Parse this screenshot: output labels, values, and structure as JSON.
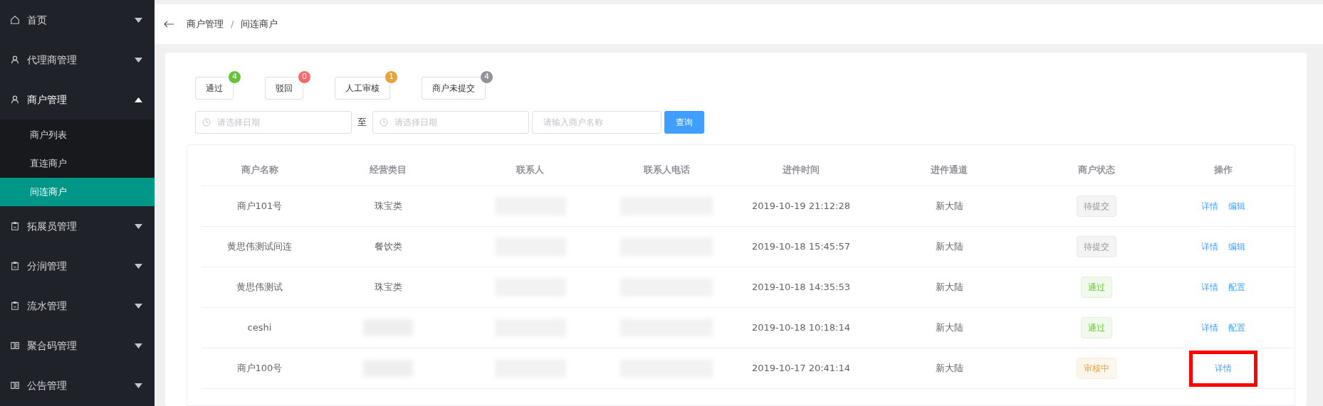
{
  "sidebar": {
    "items": [
      {
        "label": "首页",
        "expanded": false
      },
      {
        "label": "代理商管理",
        "expanded": false
      },
      {
        "label": "商户管理",
        "expanded": true,
        "children": [
          {
            "label": "商户列表",
            "selected": false
          },
          {
            "label": "直连商户",
            "selected": false
          },
          {
            "label": "间连商户",
            "selected": true
          }
        ]
      },
      {
        "label": "拓展员管理",
        "expanded": false
      },
      {
        "label": "分润管理",
        "expanded": false
      },
      {
        "label": "流水管理",
        "expanded": false
      },
      {
        "label": "聚合码管理",
        "expanded": false
      },
      {
        "label": "公告管理",
        "expanded": false
      }
    ]
  },
  "breadcrumb": [
    "商户管理",
    "/",
    "间连商户"
  ],
  "status_filters": [
    {
      "label": "通过",
      "count": "4",
      "color": "#67c23a"
    },
    {
      "label": "驳回",
      "count": "0",
      "color": "#f56c6c"
    },
    {
      "label": "人工审核",
      "count": "1",
      "color": "#e6a23c"
    },
    {
      "label": "商户未提交",
      "count": "4",
      "color": "#909399"
    }
  ],
  "search": {
    "start_date": {
      "placeholder": "请选择日期"
    },
    "separator": "至",
    "end_date": {
      "placeholder": "请选择日期"
    },
    "name": {
      "placeholder": "请输入商户名称"
    },
    "button": "查询"
  },
  "table": {
    "columns": [
      "商户名称",
      "经营类目",
      "联系人",
      "联系人电话",
      "进件时间",
      "进件通道",
      "商户状态",
      "操作"
    ],
    "rows": [
      {
        "name": "商户101号",
        "category": "珠宝类",
        "time": "2019-10-19 21:12:28",
        "channel": "新大陆",
        "status": {
          "label": "待提交",
          "kind": "pending"
        },
        "actions": [
          "详情",
          "编辑"
        ],
        "highlighted": false
      },
      {
        "name": "黄思伟测试间连",
        "category": "餐饮类",
        "time": "2019-10-18 15:45:57",
        "channel": "新大陆",
        "status": {
          "label": "待提交",
          "kind": "pending"
        },
        "actions": [
          "详情",
          "编辑"
        ],
        "highlighted": false
      },
      {
        "name": "黄思伟测试",
        "category": "珠宝类",
        "time": "2019-10-18 14:35:53",
        "channel": "新大陆",
        "status": {
          "label": "通过",
          "kind": "passed"
        },
        "actions": [
          "详情",
          "配置"
        ],
        "highlighted": false
      },
      {
        "name": "ceshi",
        "time": "2019-10-18 10:18:14",
        "channel": "新大陆",
        "status": {
          "label": "通过",
          "kind": "passed"
        },
        "actions": [
          "详情",
          "配置"
        ],
        "highlighted": false
      },
      {
        "name": "商户100号",
        "time": "2019-10-17 20:41:14",
        "channel": "新大陆",
        "status": {
          "label": "审核中",
          "kind": "reviewing"
        },
        "actions": [
          "详情"
        ],
        "highlighted": true
      }
    ]
  }
}
